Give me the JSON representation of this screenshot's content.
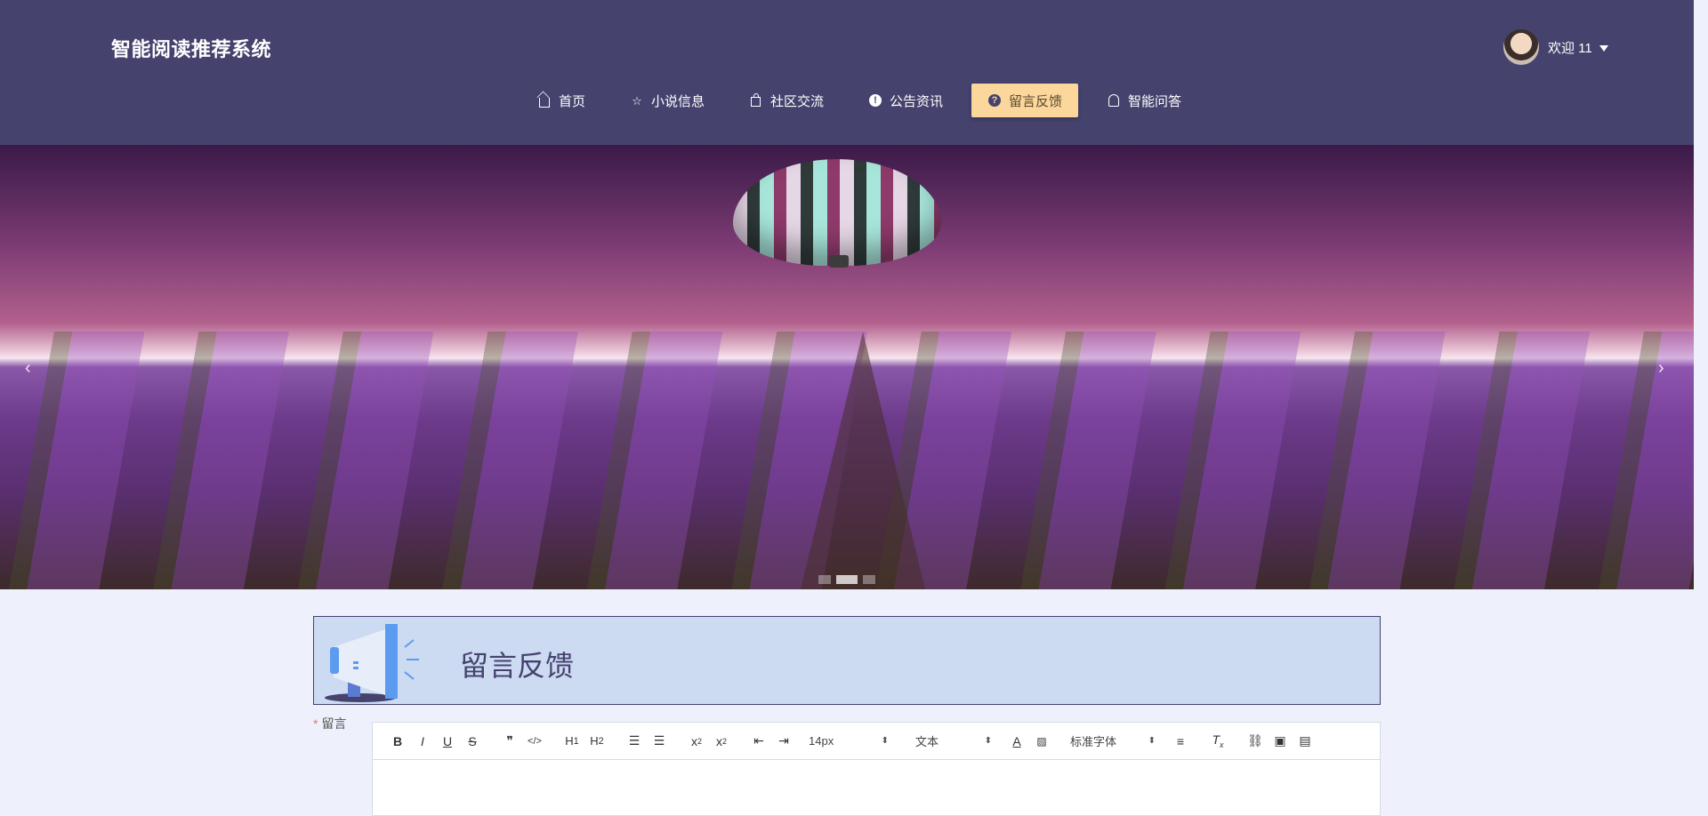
{
  "header": {
    "logo": "智能阅读推荐系统",
    "user": {
      "greeting": "欢迎 11"
    },
    "nav": [
      {
        "label": "首页",
        "icon": "home-icon"
      },
      {
        "label": "小说信息",
        "icon": "star-icon"
      },
      {
        "label": "社区交流",
        "icon": "bag-icon"
      },
      {
        "label": "公告资讯",
        "icon": "info-icon"
      },
      {
        "label": "留言反馈",
        "icon": "question-icon",
        "active": true
      },
      {
        "label": "智能问答",
        "icon": "robot-icon"
      }
    ],
    "colors": {
      "header_bg": "#45436e",
      "active_nav": "#fbd79b"
    }
  },
  "banner": {
    "prev": "‹",
    "next": "›",
    "slides": 3,
    "active_slide": 2
  },
  "form": {
    "section_title": "留言反馈",
    "field_label": "留言",
    "required_mark": "*",
    "editor": {
      "font_size": "14px",
      "paragraph_type": "文本",
      "font_family": "标准字体"
    }
  }
}
